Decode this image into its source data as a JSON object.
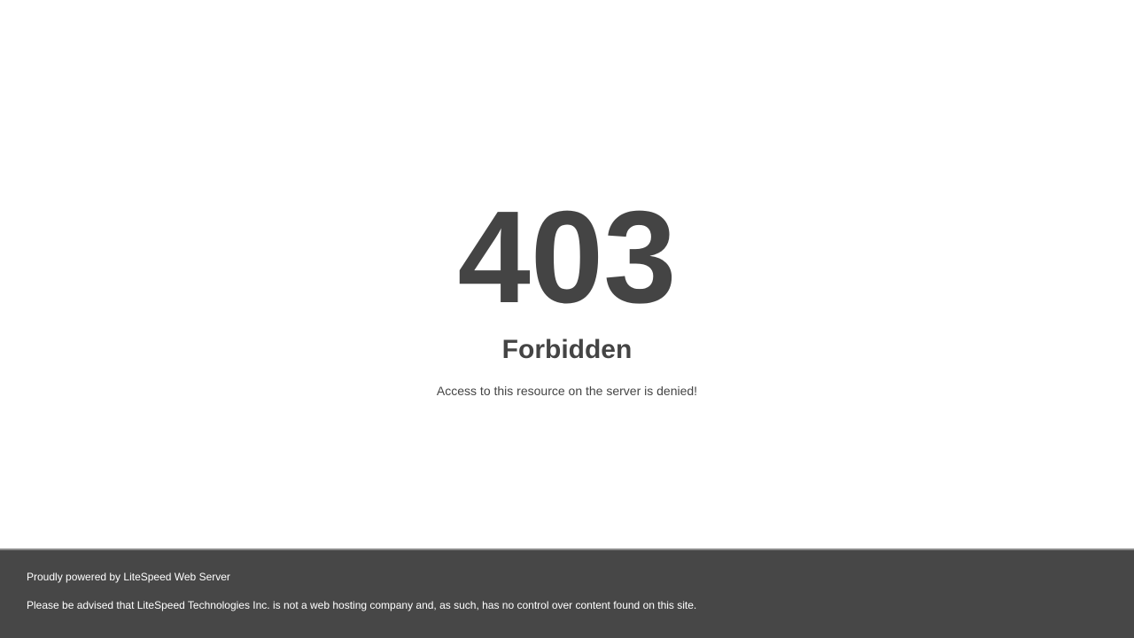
{
  "error": {
    "code": "403",
    "title": "Forbidden",
    "message": "Access to this resource on the server is denied!"
  },
  "footer": {
    "powered_by": "Proudly powered by LiteSpeed Web Server",
    "advisory": "Please be advised that LiteSpeed Technologies Inc. is not a web hosting company and, as such, has no control over content found on this site."
  },
  "colors": {
    "text": "#444444",
    "footer_background": "#474747",
    "footer_text": "#ffffff"
  }
}
